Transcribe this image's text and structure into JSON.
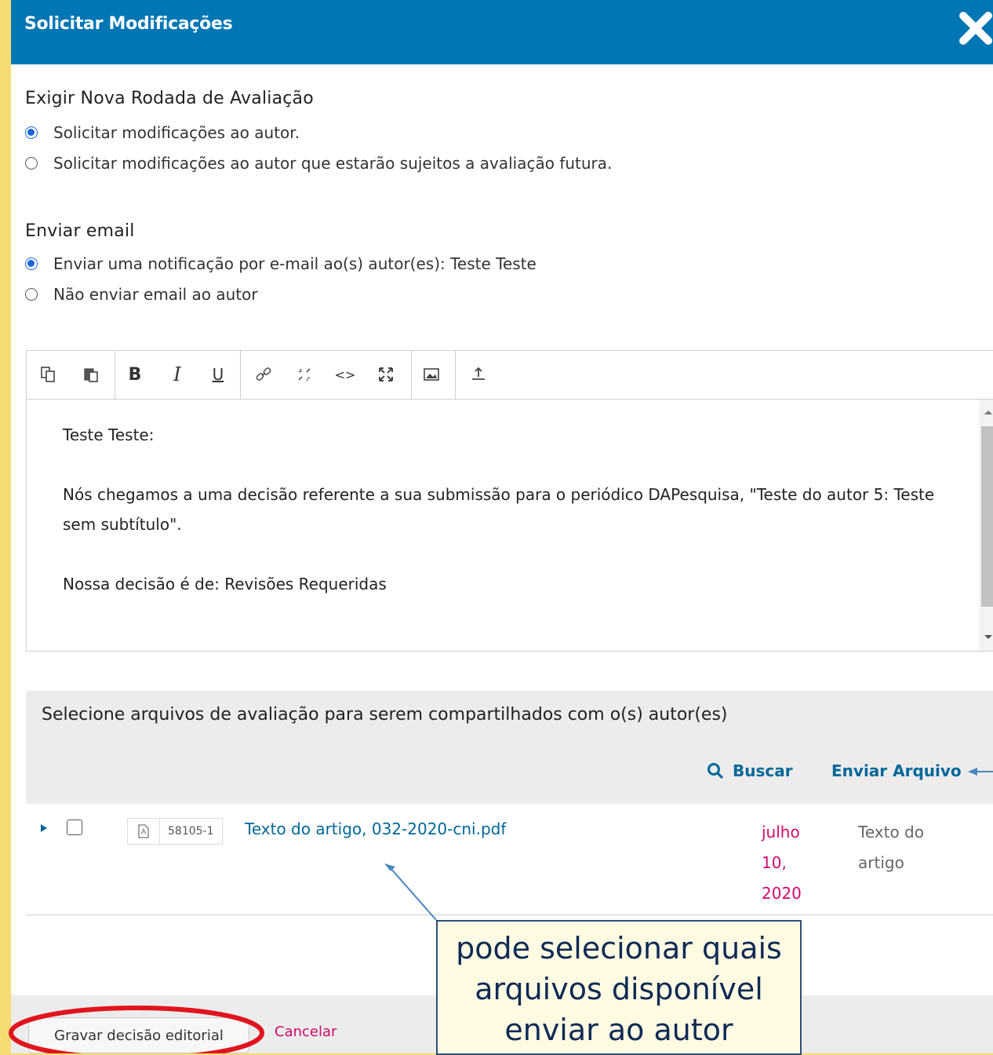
{
  "dialog": {
    "title": "Solicitar Modificações",
    "close_icon": "close-icon"
  },
  "review_round": {
    "heading": "Exigir Nova Rodada de Avaliação",
    "options": [
      {
        "label": "Solicitar modificações ao autor.",
        "checked": true
      },
      {
        "label": "Solicitar modificações ao autor que estarão sujeitos a avaliação futura.",
        "checked": false
      }
    ]
  },
  "email": {
    "heading": "Enviar email",
    "options": [
      {
        "label": "Enviar uma notificação por e-mail ao(s) autor(es): Teste Teste",
        "checked": true
      },
      {
        "label": "Não enviar email ao autor",
        "checked": false
      }
    ]
  },
  "editor": {
    "toolbar": [
      "copy-icon",
      "paste-icon",
      "bold-icon",
      "italic-icon",
      "underline-icon",
      "link-icon",
      "unlink-icon",
      "code-icon",
      "fullscreen-icon",
      "image-icon",
      "upload-icon"
    ],
    "paragraphs": [
      "Teste Teste:",
      "Nós chegamos a uma decisão referente a sua submissão para o periódico DAPesquisa, \"Teste do autor 5: Teste sem subtítulo\".",
      "Nossa decisão é de: Revisões Requeridas"
    ]
  },
  "files": {
    "heading": "Selecione arquivos de avaliação para serem compartilhados com o(s) autor(es)",
    "search_label": "Buscar",
    "upload_label": "Enviar Arquivo",
    "rows": [
      {
        "id": "58105-1",
        "name": "Texto do artigo, 032-2020-cni.pdf",
        "date_lines": [
          "julho",
          "10,",
          "2020"
        ],
        "type_lines": [
          "Texto do",
          "artigo"
        ],
        "checked": false
      }
    ]
  },
  "footer": {
    "save_label": "Gravar decisão editorial",
    "cancel_label": "Cancelar"
  },
  "annotation": {
    "lines": [
      "pode selecionar quais",
      "arquivos disponível",
      "enviar ao autor"
    ]
  },
  "colors": {
    "header": "#0076b4",
    "link": "#006798",
    "date": "#d00a6c",
    "highlight": "#e0141e",
    "background": "#f6dc72"
  }
}
